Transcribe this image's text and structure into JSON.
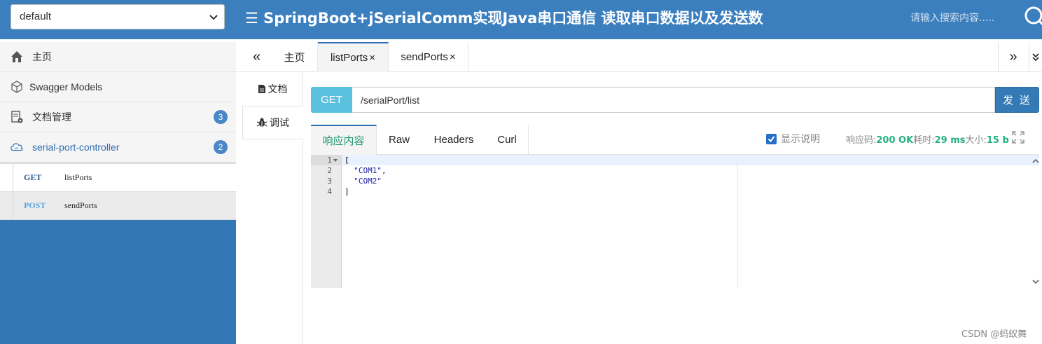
{
  "header": {
    "group_select": "default",
    "title": "☰ SpringBoot+jSerialComm实现Java串口通信 读取串口数据以及发送数",
    "search_placeholder": "请输入搜索内容....."
  },
  "sidebar": {
    "items": [
      {
        "label": "主页",
        "icon": "home-icon"
      },
      {
        "label": "Swagger Models",
        "icon": "cube-icon"
      },
      {
        "label": "文档管理",
        "icon": "document-settings-icon",
        "badge": "3"
      },
      {
        "label": "serial-port-controller",
        "icon": "cloud-api-icon",
        "badge": "2"
      }
    ],
    "apis": [
      {
        "method": "GET",
        "name": "listPorts"
      },
      {
        "method": "POST",
        "name": "sendPorts"
      }
    ]
  },
  "tabs": {
    "items": [
      {
        "label": "主页"
      },
      {
        "label": "listPorts",
        "close": "×"
      },
      {
        "label": "sendPorts",
        "close": "×"
      }
    ],
    "left_arrow": "«",
    "right_arrow": "»"
  },
  "doc_tabs": [
    {
      "label": "文档",
      "icon": "file-icon"
    },
    {
      "label": "调试",
      "icon": "bug-icon"
    }
  ],
  "request": {
    "method": "GET",
    "url": "/serialPort/list",
    "send_label": "发 送"
  },
  "response": {
    "tabs": [
      "响应内容",
      "Raw",
      "Headers",
      "Curl"
    ],
    "show_desc_label": "显示说明",
    "code_label": "响应码:",
    "code_value": "200 OK",
    "time_label": "耗时:",
    "time_value": "29 ms",
    "size_label": "大小:",
    "size_value": "15 b",
    "lines": [
      {
        "no": "1",
        "text": "["
      },
      {
        "no": "2",
        "text": "  \"COM1\","
      },
      {
        "no": "3",
        "text": "  \"COM2\""
      },
      {
        "no": "4",
        "text": "]"
      }
    ]
  },
  "watermark": "CSDN @蚂蚁舞",
  "colors": {
    "header_bg": "#3c7fbe",
    "sidebar_bg": "#3477b6",
    "get_chip": "#5bc0de",
    "send_button": "#337ab7",
    "success": "#22b07d"
  }
}
